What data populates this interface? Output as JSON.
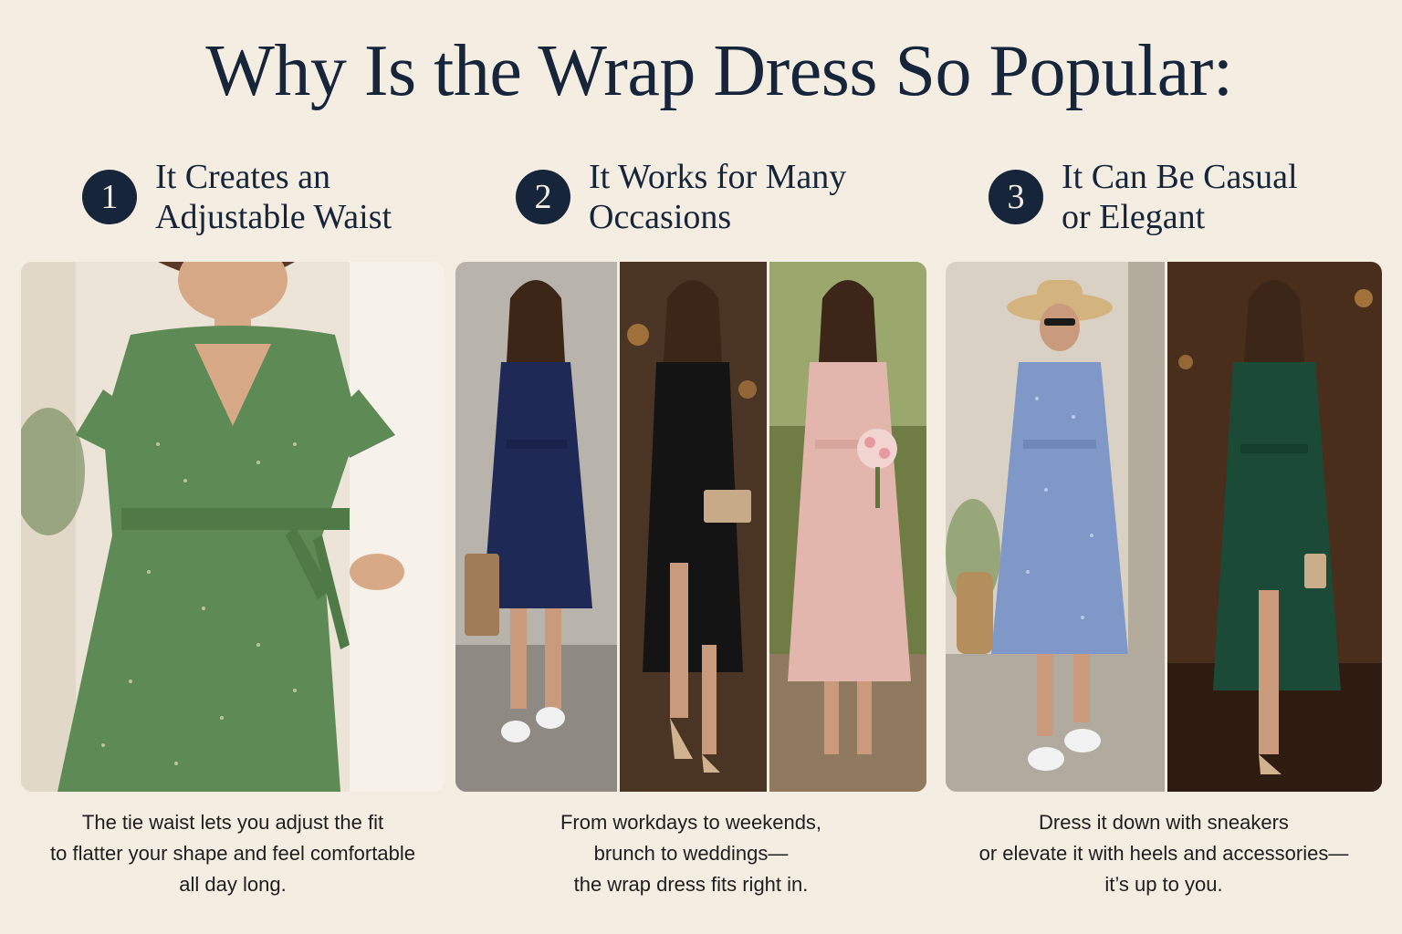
{
  "title": "Why Is the Wrap Dress So Popular:",
  "sections": [
    {
      "number": "1",
      "heading_line1": "It Creates an",
      "heading_line2": "Adjustable Waist",
      "caption_line1": "The tie waist lets you adjust the fit",
      "caption_line2": "to flatter your shape and feel comfortable",
      "caption_line3": "all day long.",
      "photos": [
        {
          "subject": "woman tying green floral wrap dress at waist",
          "dress_color": "#5d8a55",
          "bg_color": "#ece4d6"
        }
      ]
    },
    {
      "number": "2",
      "heading_line1": "It Works for Many",
      "heading_line2": "Occasions",
      "caption_line1": "From workdays to weekends,",
      "caption_line2": "brunch to weddings—",
      "caption_line3": "the wrap dress fits right in.",
      "photos": [
        {
          "subject": "navy wrap dress with sneakers and tote",
          "dress_color": "#1e2a55",
          "bg_color": "#b9b4ab"
        },
        {
          "subject": "black wrap dress with heels and clutch",
          "dress_color": "#141414",
          "bg_color": "#4a3424"
        },
        {
          "subject": "blush pink wrap dress with bouquet",
          "dress_color": "#e2b6ad",
          "bg_color": "#6f7d45"
        }
      ]
    },
    {
      "number": "3",
      "heading_line1": "It Can Be Casual",
      "heading_line2": "or Elegant",
      "caption_line1": "Dress it down with sneakers",
      "caption_line2": "or elevate it with heels and accessories—",
      "caption_line3": "it’s up to you.",
      "photos": [
        {
          "subject": "blue floral wrap dress with straw hat and sneakers",
          "dress_color": "#7f98c8",
          "bg_color": "#d9d2c4"
        },
        {
          "subject": "emerald satin wrap dress with heels",
          "dress_color": "#1b4a37",
          "bg_color": "#4a2e1c"
        }
      ]
    }
  ]
}
